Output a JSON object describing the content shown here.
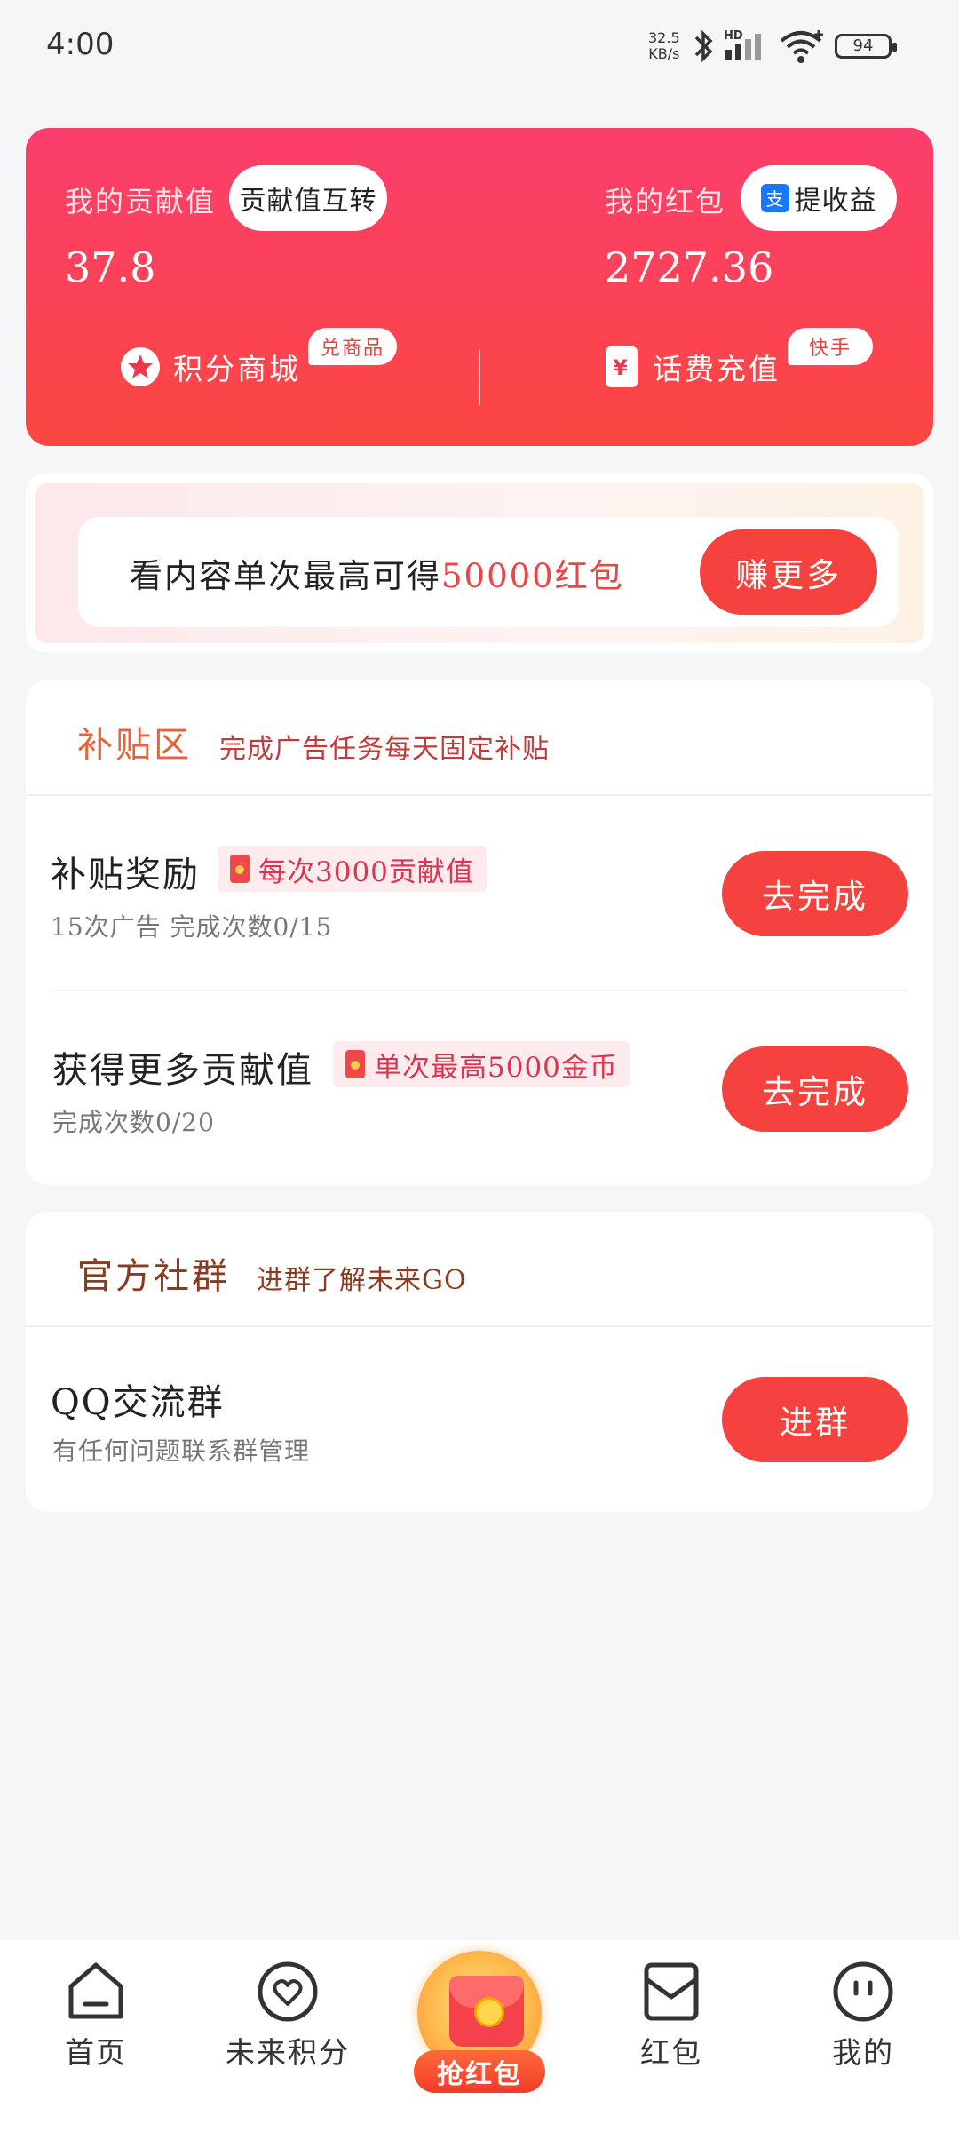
{
  "status_bar": {
    "time": "4:00",
    "net_speed": "32.5",
    "net_unit": "KB/s",
    "battery": "94"
  },
  "top_card": {
    "contribution_label": "我的贡献值",
    "contribution_transfer_button": "贡献值互转",
    "contribution_value": "37.8",
    "redpacket_label": "我的红包",
    "withdraw_button": "提收益",
    "redpacket_value": "2727.36",
    "points_mall_label": "积分商城",
    "points_mall_tag": "兑商品",
    "recharge_label": "话费充值",
    "recharge_tag": "快手"
  },
  "banner": {
    "text_prefix": "看内容单次最高可得",
    "text_highlight": "50000红包",
    "button": "赚更多"
  },
  "subsidy": {
    "title": "补贴区",
    "subtitle": "完成广告任务每天固定补贴",
    "rows": [
      {
        "title": "补贴奖励",
        "badge": "每次3000贡献值",
        "detail": "15次广告  完成次数0/15",
        "button": "去完成"
      },
      {
        "title": "获得更多贡献值",
        "badge": "单次最高5000金币",
        "detail": "完成次数0/20",
        "button": "去完成"
      }
    ]
  },
  "community": {
    "title": "官方社群",
    "subtitle": "进群了解未来GO",
    "rows": [
      {
        "title": "QQ交流群",
        "detail": "有任何问题联系群管理",
        "button": "进群"
      }
    ]
  },
  "tabbar": {
    "home": "首页",
    "points": "未来积分",
    "grab": "抢红包",
    "redpacket": "红包",
    "mine": "我的"
  },
  "colors": {
    "accent": "#f5423e",
    "card_top": "#fb3e6c",
    "card_bottom": "#fc4740"
  },
  "icons": [
    "wifi-icon",
    "bluetooth-icon",
    "signal-icon",
    "battery-icon",
    "alipay-icon",
    "star-icon",
    "yen-icon",
    "envelope-icon",
    "home-icon",
    "heart-icon",
    "grab-redpacket-icon",
    "redpacket-icon",
    "face-icon"
  ]
}
